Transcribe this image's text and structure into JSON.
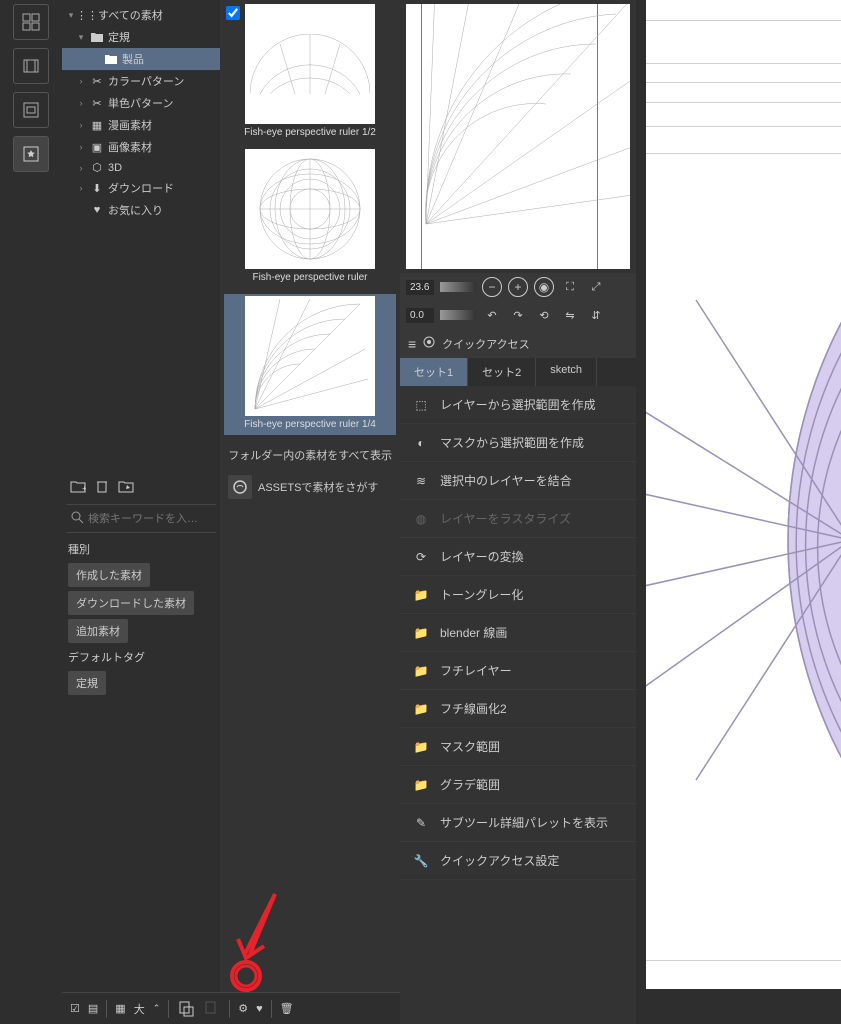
{
  "tree": {
    "root": "すべての素材",
    "folder_ruler": "定規",
    "folder_product": "製品",
    "color_pattern": "カラーパターン",
    "mono_pattern": "単色パターン",
    "manga": "漫画素材",
    "image": "画像素材",
    "threed": "3D",
    "download": "ダウンロード",
    "favorite": "お気に入り"
  },
  "search_placeholder": "検索キーワードを入…",
  "filter": {
    "type_label": "種別",
    "created": "作成した素材",
    "downloaded": "ダウンロードした素材",
    "added": "追加素材",
    "default_tag": "デフォルトタグ",
    "ruler": "定規"
  },
  "assets": {
    "a1": "Fish-eye perspective ruler 1/2",
    "a2": "Fish-eye perspective ruler",
    "a3": "Fish-eye perspective ruler 1/4",
    "show_all": "フォルダー内の素材をすべて表示",
    "assets_search": "ASSETSで素材をさがす"
  },
  "nav": {
    "zoom": "23.6",
    "angle": "0.0"
  },
  "qa": {
    "title": "クイックアクセス",
    "tab1": "セット1",
    "tab2": "セット2",
    "tab3": "sketch",
    "i1": "レイヤーから選択範囲を作成",
    "i2": "マスクから選択範囲を作成",
    "i3": "選択中のレイヤーを結合",
    "i4": "レイヤーをラスタライズ",
    "i5": "レイヤーの変換",
    "i6": "トーングレー化",
    "i7": "blender 線画",
    "i8": "フチレイヤー",
    "i9": "フチ線画化2",
    "i10": "マスク範囲",
    "i11": "グラデ範囲",
    "i12": "サブツール詳細パレットを表示",
    "i13": "クイックアクセス設定"
  },
  "bottom": {
    "size": "大"
  },
  "colors": {
    "selection": "#5a6d87",
    "purple_fill": "#d7cdef",
    "purple_stroke": "#9a91b8",
    "annotation": "#e8222a"
  }
}
